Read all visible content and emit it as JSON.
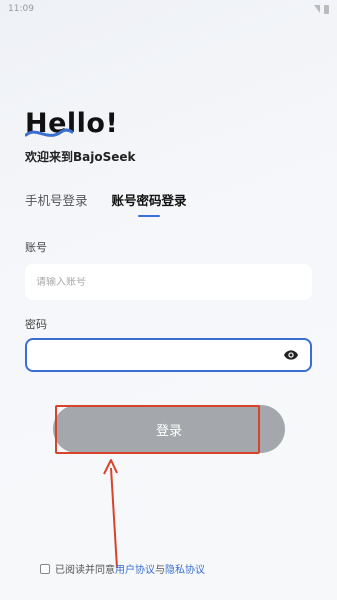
{
  "status_bar": {
    "time": "11:09"
  },
  "header": {
    "hello": "Hello!",
    "welcome": "欢迎来到BajoSeek"
  },
  "tabs": [
    {
      "label": "手机号登录",
      "active": false
    },
    {
      "label": "账号密码登录",
      "active": true
    }
  ],
  "form": {
    "account_label": "账号",
    "account_placeholder": "请输入账号",
    "account_value": "",
    "password_label": "密码",
    "password_placeholder": "",
    "password_value": ""
  },
  "login_button": {
    "label": "登录"
  },
  "agreement": {
    "prefix": "已阅读并同意",
    "user_agreement": "用户协议",
    "and": "与",
    "privacy_policy": "隐私协议",
    "checked": false
  },
  "colors": {
    "accent": "#3a6fd1",
    "button": "#a4a8ad",
    "annotation": "#d8432b"
  },
  "icons": {
    "password_toggle": "eye-icon"
  }
}
